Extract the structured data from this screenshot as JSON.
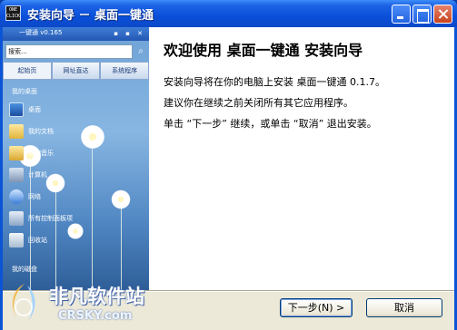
{
  "window": {
    "title": "安装向导 － 桌面一键通",
    "app_icon_text": "ONE\nCLICK"
  },
  "side_panel": {
    "title": "一键通 v0.165",
    "search_placeholder": "搜索...",
    "tabs": [
      {
        "label": "起始页"
      },
      {
        "label": "网址直达"
      },
      {
        "label": "系统程序"
      }
    ],
    "section_header": "我的桌面",
    "items": [
      {
        "label": "桌面",
        "icon": "desktop-icon"
      },
      {
        "label": "我的文档",
        "icon": "folder-icon"
      },
      {
        "label": "我的音乐",
        "icon": "music-folder-icon"
      },
      {
        "label": "计算机",
        "icon": "computer-icon"
      },
      {
        "label": "网络",
        "icon": "network-icon"
      },
      {
        "label": "所有控制面板项",
        "icon": "control-panel-icon"
      },
      {
        "label": "回收站",
        "icon": "recycle-bin-icon"
      }
    ],
    "footer_header": "我的磁盘"
  },
  "content": {
    "heading": "欢迎使用 桌面一键通 安装向导",
    "line1": "安装向导将在你的电脑上安装 桌面一键通 0.1.7。",
    "line2": "建议你在继续之前关闭所有其它应用程序。",
    "line3": "单击 “下一步” 继续，或单击 “取消” 退出安装。"
  },
  "buttons": {
    "next_label": "下一步(N) >",
    "cancel_label": "取消"
  },
  "watermark": {
    "main": "非凡软件站",
    "sub": "CRSKY.com"
  },
  "colors": {
    "titlebar": "#0a4fd9",
    "client_bg": "#ece9d8",
    "close_button": "#c8421c"
  }
}
